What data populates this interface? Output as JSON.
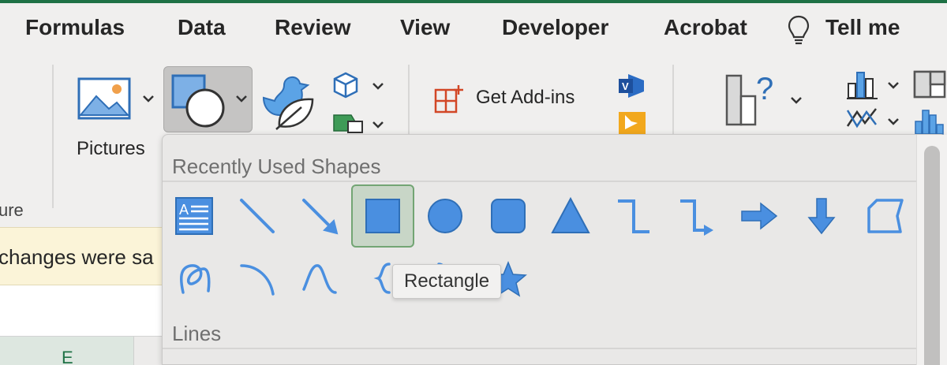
{
  "tabs": [
    "Formulas",
    "Data",
    "Review",
    "View",
    "Developer",
    "Acrobat",
    "Tell me"
  ],
  "ribbon": {
    "pictures_label": "Pictures",
    "group_label_partial": "ure",
    "get_addins_label": "Get Add-ins"
  },
  "banner": {
    "text": "changes were sa"
  },
  "sheet": {
    "column_header": "E"
  },
  "shapes_menu": {
    "recent_header": "Recently Used Shapes",
    "lines_header": "Lines",
    "tooltip": "Rectangle",
    "recent_row1": [
      "text-box-icon",
      "line-icon",
      "arrow-line-icon",
      "rectangle-icon",
      "oval-icon",
      "rounded-rectangle-icon",
      "triangle-icon",
      "elbow-connector-icon",
      "elbow-arrow-connector-icon",
      "right-arrow-icon",
      "down-arrow-icon",
      "snip-corner-rectangle-icon"
    ],
    "recent_row2": [
      "curve-loop-icon",
      "arc-icon",
      "wave-curve-icon",
      "left-brace-icon"
    ]
  },
  "colors": {
    "accent_blue": "#4a8fe0",
    "excel_green": "#1e7145",
    "selected_fill": "#c8d6c7"
  }
}
